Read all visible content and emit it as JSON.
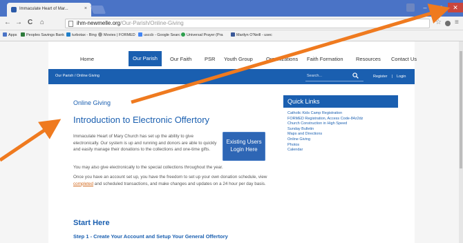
{
  "browser": {
    "tab_title": "Immaculate Heart of Mar...",
    "tab_close": "×",
    "url_host": "ihm-newmelle.org",
    "url_path": "/Our-Parish/Online-Giving",
    "back": "←",
    "forward": "→",
    "reload": "C",
    "home": "⌂",
    "star": "☆",
    "menu": "≡",
    "minimize": "–",
    "maximize": "□",
    "close": "✕",
    "bookmarks": [
      {
        "label": "Apps",
        "color": "#4a73c6"
      },
      {
        "label": "Peoples Savings Bank",
        "color": "#2d7a3b"
      },
      {
        "label": "turbotax - Bing",
        "color": "#1f7fc9"
      },
      {
        "label": "Movies | FORMED",
        "color": "#999999"
      },
      {
        "label": "usccb - Google Searc",
        "color": "#4285f4"
      },
      {
        "label": "Universal Prayer (Pra",
        "color": "#2e9f4e"
      },
      {
        "label": "Marilyn O'Neill - usec",
        "color": "#3b5998"
      }
    ]
  },
  "site": {
    "nav": [
      "Home",
      "Our Parish",
      "Our Faith",
      "PSR",
      "Youth Group",
      "Organizations",
      "Faith Formation",
      "Resources",
      "Contact Us"
    ],
    "active_nav": "Our Parish",
    "breadcrumb": "Our Parish  /  Online Giving",
    "search_placeholder": "Search...",
    "register_label": "Register",
    "separator": "|",
    "login_label": "Login"
  },
  "main": {
    "section_label": "Online Giving",
    "title": "Introduction to Electronic Offertory",
    "para1": "Immaculate Heart of Mary Church  has set up the ability to give electronically. Our system is up and running and donors are able to quickly and easily manage their donations to the collections and one-time gifts.",
    "para2": "You may also give electronically to the special collections throughout the year.",
    "para3_before": "Once you have an account set up, you have the freedom to set up your own donation schedule, view ",
    "para3_link": "completed",
    "para3_after": " and scheduled transactions, and make changes and updates on a 24 hour per day basis.",
    "login_button_line1": "Existing Users",
    "login_button_line2": "Login Here",
    "start_heading": "Start Here",
    "step1": "Step 1 - Create Your Account and Setup Your General Offertory"
  },
  "quick_links": {
    "title": "Quick Links",
    "items": [
      "Catholic Kids Camp Registration",
      "FORMED Registration, Access Code-84z2dz",
      "Church Construction in High Speed",
      "Sunday Bulletin",
      "Maps and Directions",
      "Online Giving",
      "Photos",
      "Calendar"
    ]
  },
  "colors": {
    "brand_blue": "#1a5fb0",
    "annotation_arrow": "#ef7a1f",
    "chrome_blue": "#4a73c6"
  }
}
